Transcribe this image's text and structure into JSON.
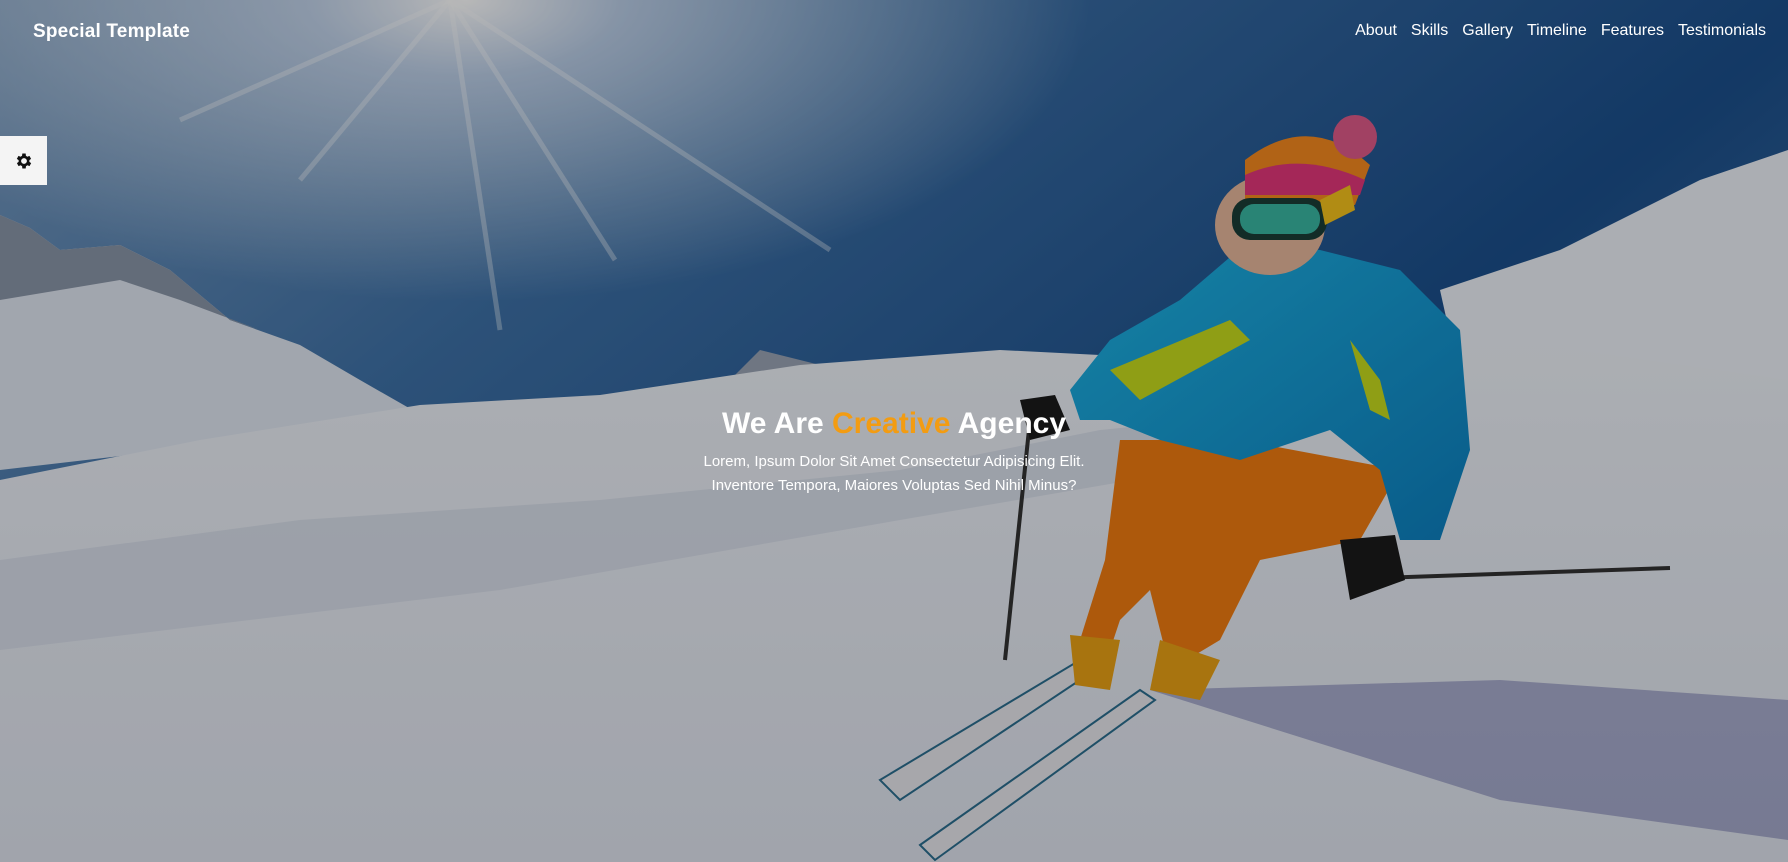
{
  "header": {
    "logo_text": "Special Template",
    "nav": [
      {
        "label": "About"
      },
      {
        "label": "Skills"
      },
      {
        "label": "Gallery"
      },
      {
        "label": "Timeline"
      },
      {
        "label": "Features"
      },
      {
        "label": "Testimonials"
      }
    ]
  },
  "settings": {
    "icon": "gear-icon"
  },
  "intro": {
    "title_before": "We Are ",
    "title_accent": "Creative",
    "title_after": " Agency",
    "description": "Lorem, Ipsum Dolor Sit Amet Consectetur Adipisicing Elit. Inventore Tempora, Maiores Voluptas Sed Nihil Minus?"
  },
  "colors": {
    "accent": "#f39c12",
    "text": "#ffffff",
    "settings_bg": "#f4f4f4"
  }
}
